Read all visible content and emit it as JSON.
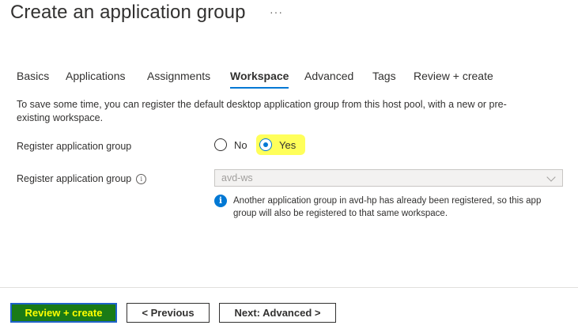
{
  "page": {
    "title": "Create an application group",
    "more_glyph": "···"
  },
  "tabs": [
    {
      "label": "Basics",
      "active": false
    },
    {
      "label": "Applications",
      "active": false
    },
    {
      "label": "Assignments",
      "active": false
    },
    {
      "label": "Workspace",
      "active": true
    },
    {
      "label": "Advanced",
      "active": false
    },
    {
      "label": "Tags",
      "active": false
    },
    {
      "label": "Review + create",
      "active": false
    }
  ],
  "workspace": {
    "description": "To save some time, you can register the default desktop application group from this host pool, with a new or pre-existing workspace.",
    "register_label": "Register application group",
    "radio_no": "No",
    "radio_yes": "Yes",
    "selected": "Yes",
    "workspace_label": "Register application group",
    "info_glyph": "i",
    "workspace_value": "avd-ws",
    "notice_icon": "info-icon",
    "notice_glyph": "i",
    "notice": "Another application group in avd-hp has already been registered, so this app group will also be registered to that same workspace."
  },
  "footer": {
    "review_create": "Review + create",
    "previous": "< Previous",
    "next": "Next: Advanced >"
  },
  "colors": {
    "accent": "#0078d4",
    "highlight": "#ffff5a",
    "primary_button_bg": "#1a7b16",
    "primary_button_text": "#ffff00"
  }
}
